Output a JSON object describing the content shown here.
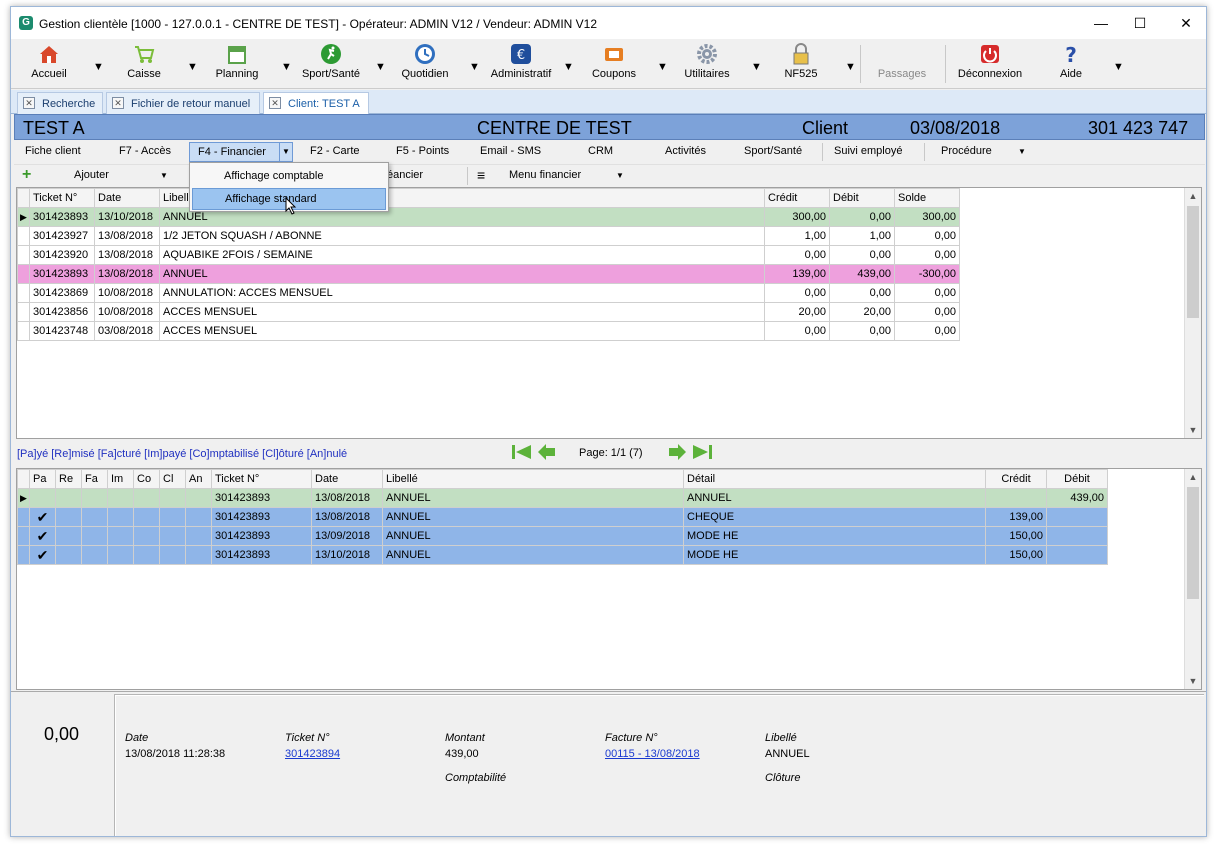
{
  "window": {
    "title": "Gestion clientèle [1000 - 127.0.0.1 - CENTRE DE TEST] - Opérateur: ADMIN V12 / Vendeur: ADMIN V12",
    "minimize": "—",
    "maximize": "☐",
    "close": "✕"
  },
  "toolbar": [
    {
      "label": "Accueil",
      "icon": "home-icon",
      "color": "#d9482b"
    },
    {
      "label": "Caisse",
      "icon": "cart-icon",
      "color": "#7bbd3a"
    },
    {
      "label": "Planning",
      "icon": "calendar-icon",
      "color": "#5aa24a"
    },
    {
      "label": "Sport/Santé",
      "icon": "runner-icon",
      "color": "#2c9a33"
    },
    {
      "label": "Quotidien",
      "icon": "clock-icon",
      "color": "#2f6fbf"
    },
    {
      "label": "Administratif",
      "icon": "euro-icon",
      "color": "#1f4e9c"
    },
    {
      "label": "Coupons",
      "icon": "coupon-icon",
      "color": "#e67e22"
    },
    {
      "label": "Utilitaires",
      "icon": "gear-icon",
      "color": "#8a96a8"
    },
    {
      "label": "NF525",
      "icon": "lock-icon",
      "color": "#c7a030"
    },
    {
      "label": "Passages",
      "icon": "",
      "color": "#888888"
    },
    {
      "label": "Déconnexion",
      "icon": "power-icon",
      "color": "#d62b2b"
    },
    {
      "label": "Aide",
      "icon": "help-icon",
      "color": "#2a4fa8"
    }
  ],
  "tabs": [
    {
      "label": "Recherche"
    },
    {
      "label": "Fichier de retour manuel"
    },
    {
      "label": "Client: TEST A"
    }
  ],
  "client": {
    "name": "TEST A",
    "center": "CENTRE DE TEST",
    "kind": "Client",
    "date": "03/08/2018",
    "phone": "301 423 747"
  },
  "menu": [
    "Fiche client",
    "F7 - Accès",
    "F4 - Financier",
    "F2 - Carte",
    "F5 - Points",
    "Email - SMS",
    "CRM",
    "Activités",
    "Sport/Santé",
    "Suivi employé",
    "Procédure"
  ],
  "submenu": {
    "add": "Ajouter",
    "schedule": "éancier",
    "fin_menu": "Menu financier"
  },
  "dropdown": [
    "Affichage comptable",
    "Affichage standard"
  ],
  "grid1": {
    "headers": [
      "Ticket N°",
      "Date",
      "Libellé",
      "Crédit",
      "Débit",
      "Solde"
    ],
    "rows": [
      {
        "ticket": "301423893",
        "date": "13/10/2018",
        "libelle": "ANNUEL",
        "credit": "300,00",
        "debit": "0,00",
        "solde": "300,00",
        "style": "green"
      },
      {
        "ticket": "301423927",
        "date": "13/08/2018",
        "libelle": "1/2 JETON SQUASH / ABONNE",
        "credit": "1,00",
        "debit": "1,00",
        "solde": "0,00",
        "style": ""
      },
      {
        "ticket": "301423920",
        "date": "13/08/2018",
        "libelle": "AQUABIKE 2FOIS / SEMAINE",
        "credit": "0,00",
        "debit": "0,00",
        "solde": "0,00",
        "style": ""
      },
      {
        "ticket": "301423893",
        "date": "13/08/2018",
        "libelle": "ANNUEL",
        "credit": "139,00",
        "debit": "439,00",
        "solde": "-300,00",
        "style": "pink"
      },
      {
        "ticket": "301423869",
        "date": "10/08/2018",
        "libelle": "ANNULATION: ACCES MENSUEL",
        "credit": "0,00",
        "debit": "0,00",
        "solde": "0,00",
        "style": ""
      },
      {
        "ticket": "301423856",
        "date": "10/08/2018",
        "libelle": "ACCES MENSUEL",
        "credit": "20,00",
        "debit": "20,00",
        "solde": "0,00",
        "style": ""
      },
      {
        "ticket": "301423748",
        "date": "03/08/2018",
        "libelle": "ACCES MENSUEL",
        "credit": "0,00",
        "debit": "0,00",
        "solde": "0,00",
        "style": ""
      }
    ]
  },
  "legend": "[Pa]yé [Re]misé [Fa]cturé [Im]payé [Co]mptabilisé [Cl]ôturé [An]nulé",
  "pager": "Page: 1/1 (7)",
  "grid2": {
    "headers": [
      "Pa",
      "Re",
      "Fa",
      "Im",
      "Co",
      "Cl",
      "An",
      "Ticket N°",
      "Date",
      "Libellé",
      "Détail",
      "Crédit",
      "Débit"
    ],
    "rows": [
      {
        "pa": "",
        "ticket": "301423893",
        "date": "13/08/2018",
        "libelle": "ANNUEL",
        "detail": "ANNUEL",
        "credit": "",
        "debit": "439,00",
        "style": "green"
      },
      {
        "pa": "✔",
        "ticket": "301423893",
        "date": "13/08/2018",
        "libelle": "ANNUEL",
        "detail": "CHEQUE",
        "credit": "139,00",
        "debit": "",
        "style": "blue"
      },
      {
        "pa": "✔",
        "ticket": "301423893",
        "date": "13/09/2018",
        "libelle": "ANNUEL",
        "detail": "MODE HE",
        "credit": "150,00",
        "debit": "",
        "style": "blue"
      },
      {
        "pa": "✔",
        "ticket": "301423893",
        "date": "13/10/2018",
        "libelle": "ANNUEL",
        "detail": "MODE HE",
        "credit": "150,00",
        "debit": "",
        "style": "blue"
      }
    ]
  },
  "detail": {
    "total": "0,00",
    "date_label": "Date",
    "date_value": "13/08/2018 11:28:38",
    "ticket_label": "Ticket N°",
    "ticket_value": "301423894",
    "amount_label": "Montant",
    "amount_value": "439,00",
    "accounting_label": "Comptabilité",
    "invoice_label": "Facture N°",
    "invoice_value": "00115 - 13/08/2018",
    "libelle_label": "Libellé",
    "libelle_value": "ANNUEL",
    "closing_label": "Clôture"
  }
}
